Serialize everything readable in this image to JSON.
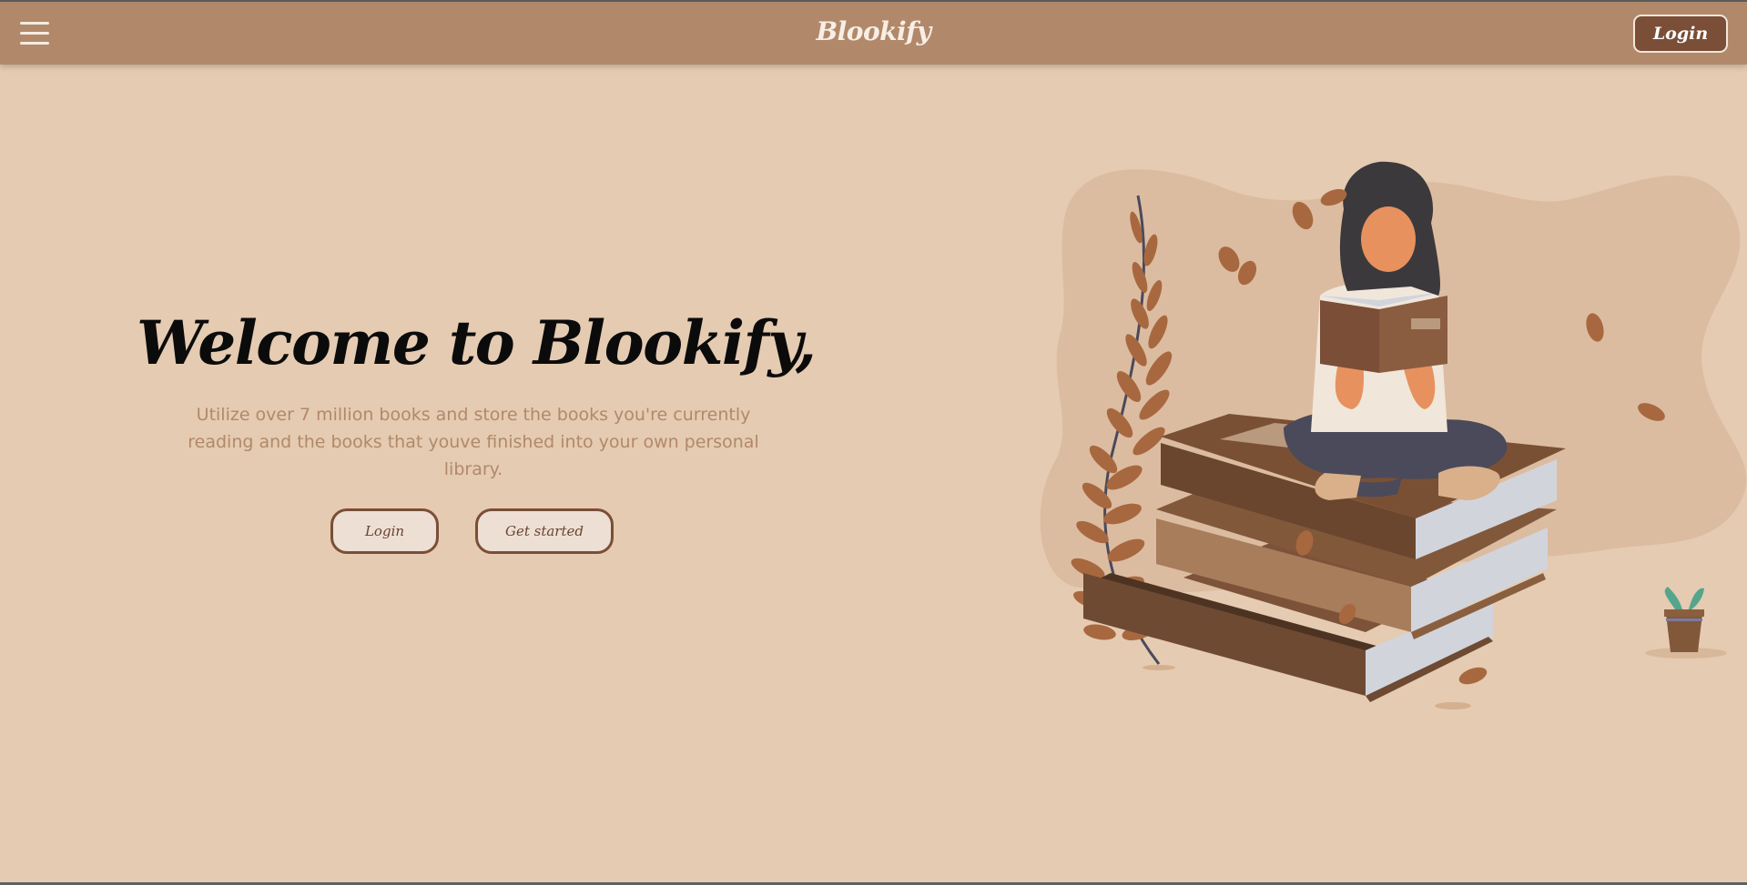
{
  "header": {
    "brand": "Blookify",
    "login_label": "Login"
  },
  "hero": {
    "title": "Welcome to Blookify,",
    "subtitle": "Utilize over 7 million books and store the books you're currently reading and the books that youve finished into your own personal library.",
    "login_label": "Login",
    "get_started_label": "Get started"
  },
  "icons": {
    "menu": "hamburger-menu-icon"
  },
  "colors": {
    "background": "#e5cbb1",
    "header": "#b1896a",
    "accent": "#7a4e37",
    "subtitle": "#b1896a"
  }
}
